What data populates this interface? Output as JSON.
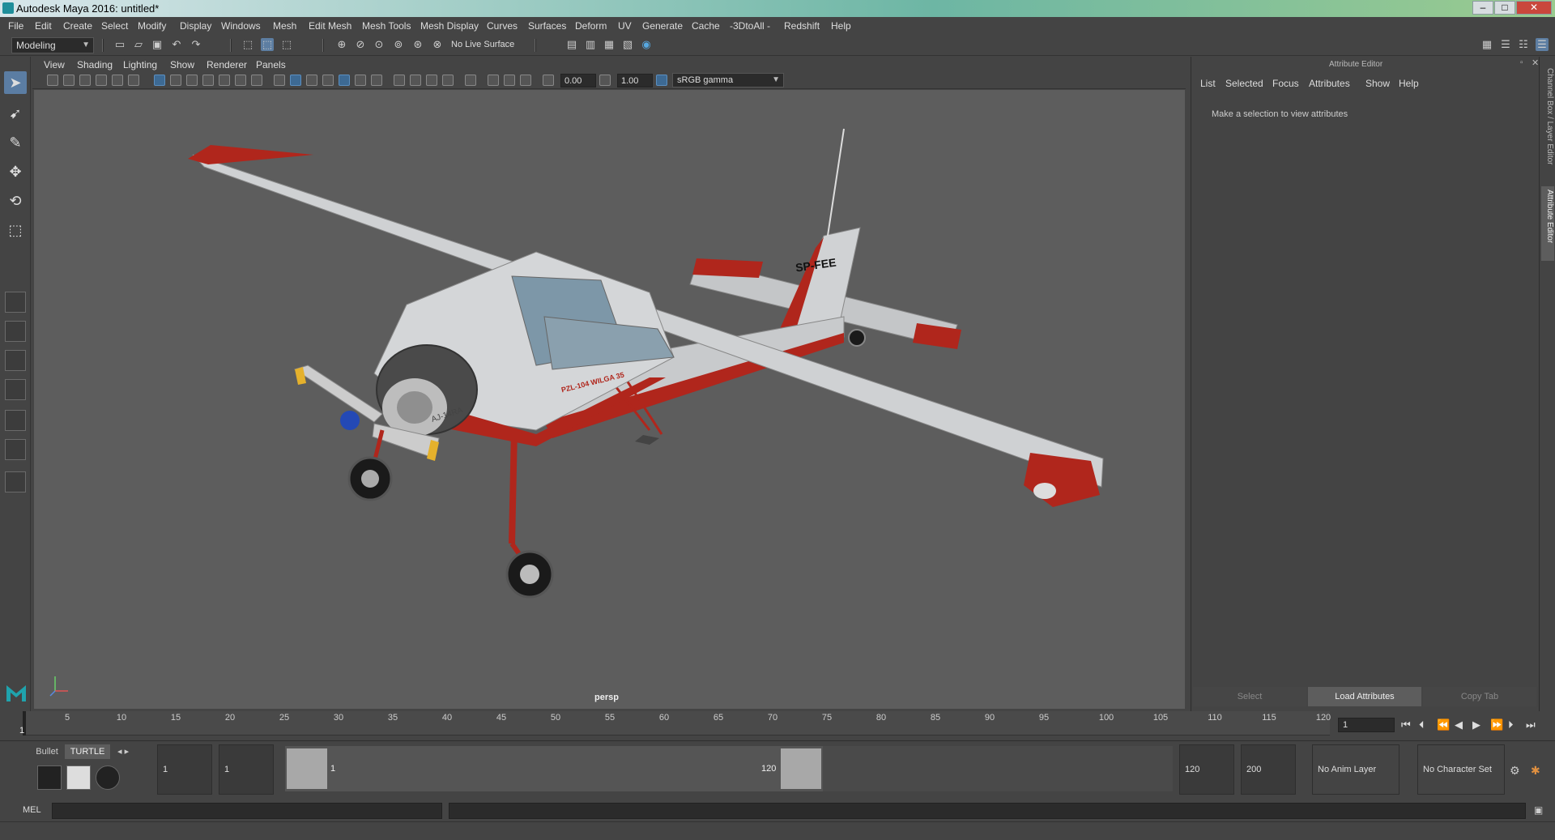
{
  "window": {
    "title": "Autodesk Maya 2016: untitled*",
    "min": "–",
    "max": "□",
    "close": "✕"
  },
  "menubar": [
    "File",
    "Edit",
    "Create",
    "Select",
    "Modify",
    "Display",
    "Windows",
    "Mesh",
    "Edit Mesh",
    "Mesh Tools",
    "Mesh Display",
    "Curves",
    "Surfaces",
    "Deform",
    "UV",
    "Generate",
    "Cache",
    "-3DtoAll -",
    "Redshift",
    "Help"
  ],
  "shelf": {
    "mode": "Modeling",
    "live_surface": "No Live Surface"
  },
  "viewport": {
    "menu": [
      "View",
      "Shading",
      "Lighting",
      "Show",
      "Renderer",
      "Panels"
    ],
    "exposure": "0.00",
    "gamma": "1.00",
    "color_space": "sRGB gamma",
    "camera": "persp",
    "aircraft": {
      "fuselage_text": "AJ-14RA",
      "tail_text": "SP-FEE",
      "side_text": "PZL-104 WILGA 35"
    }
  },
  "attribute_editor": {
    "title": "Attribute Editor",
    "menu": [
      "List",
      "Selected",
      "Focus",
      "Attributes",
      "Show",
      "Help"
    ],
    "hint": "Make a selection to view attributes",
    "buttons": {
      "select": "Select",
      "load": "Load Attributes",
      "copy": "Copy Tab"
    },
    "side_tabs": {
      "channel_box": "Channel Box / Layer Editor",
      "attr_editor": "Attribute Editor"
    }
  },
  "timeline": {
    "ticks": [
      "5",
      "10",
      "15",
      "20",
      "25",
      "30",
      "35",
      "40",
      "45",
      "50",
      "55",
      "60",
      "65",
      "70",
      "75",
      "80",
      "85",
      "90",
      "95",
      "100",
      "105",
      "110",
      "115",
      "120"
    ],
    "current_frame_label": "1",
    "current_frame": "1"
  },
  "range": {
    "tabs": {
      "bullet": "Bullet",
      "turtle": "TURTLE"
    },
    "start": "1",
    "playback_start": "1",
    "track_start_label": "1",
    "track_end_label": "120",
    "playback_end": "120",
    "end": "200",
    "anim_layer": "No Anim Layer",
    "char_set": "No Character Set"
  },
  "command": {
    "language": "MEL"
  },
  "colors": {
    "accent": "#5b7da3",
    "viewport_bg": "#5d5d5d",
    "panel_bg": "#444444",
    "aircraft_red": "#b0261c"
  }
}
